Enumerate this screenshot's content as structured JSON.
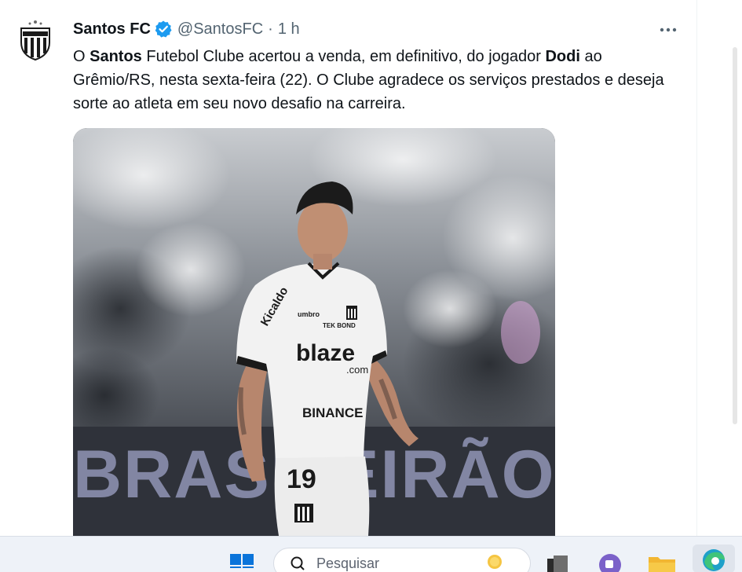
{
  "tweet": {
    "display_name": "Santos FC",
    "handle": "@SantosFC",
    "separator": "·",
    "time": "1 h",
    "text_parts": {
      "p1": "O ",
      "b1": "Santos",
      "p2": " Futebol Clube acertou a venda, em definitivo, do jogador ",
      "b2": "Dodi",
      "p3": " ao Grêmio/RS, nesta sexta-feira (22). O Clube agradece os serviços prestados e deseja sorte ao atleta em seu novo desafio na carreira."
    },
    "media": {
      "banner_text": "BRASILEIRÃO",
      "shirt_number": "19",
      "sponsor_main": "blaze",
      "sponsor_sub": ".com",
      "sponsor_chest": "BINANCE",
      "sponsor_tekbond": "TEK BOND",
      "sponsor_sleeve": "Kicaldo",
      "kit_brand": "umbro"
    },
    "colors": {
      "verified": "#1d9bf0",
      "text": "#0f1419",
      "muted": "#536471"
    }
  },
  "taskbar": {
    "search_placeholder": "Pesquisar"
  }
}
